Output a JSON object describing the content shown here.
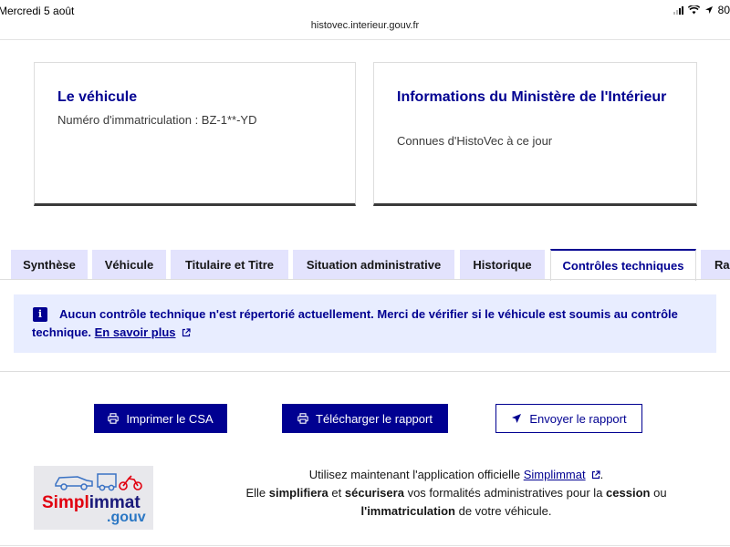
{
  "status_bar": {
    "time": "Mercredi 5 août",
    "battery": "80"
  },
  "browser": {
    "url": "histovec.interieur.gouv.fr"
  },
  "cards": [
    {
      "title": "Le véhicule",
      "text": "Numéro d'immatriculation : BZ-1**-YD"
    },
    {
      "title": "Informations du Ministère de l'Intérieur",
      "text": "Connues d'HistoVec à ce jour"
    }
  ],
  "tabs": [
    {
      "label": "Synthèse",
      "active": false
    },
    {
      "label": "Véhicule",
      "active": false
    },
    {
      "label": "Titulaire et Titre",
      "active": false
    },
    {
      "label": "Situation administrative",
      "active": false
    },
    {
      "label": "Historique",
      "active": false
    },
    {
      "label": "Contrôles techniques",
      "active": true
    },
    {
      "label": "Rap",
      "active": false
    }
  ],
  "alert": {
    "icon": "info-icon",
    "message": "Aucun contrôle technique n'est répertorié actuellement. Merci de vérifier si le véhicule est soumis au contrôle technique.",
    "link": "En savoir plus"
  },
  "actions": {
    "print": "Imprimer le CSA",
    "download": "Télécharger le rapport",
    "send": "Envoyer le rapport"
  },
  "promo": {
    "logo_word_1": "Simpl",
    "logo_word_2": "immat",
    "logo_suffix": ".gouv",
    "line1_prefix": "Utilisez maintenant l'application officielle",
    "link": "Simplimmat",
    "line1_suffix": ".",
    "line2_a": "Elle",
    "line2_b": "simplifiera",
    "line2_c": "et",
    "line2_d": "sécurisera",
    "line2_e": "vos formalités administratives pour la",
    "line2_f": "cession",
    "line2_g": "ou",
    "line3_a": "l'immatriculation",
    "line3_b": "de votre véhicule."
  },
  "colors": {
    "primary": "#000091",
    "tab_bg": "#e3e3fd",
    "alert_bg": "#e8edff",
    "logo_red": "#e1000f"
  }
}
